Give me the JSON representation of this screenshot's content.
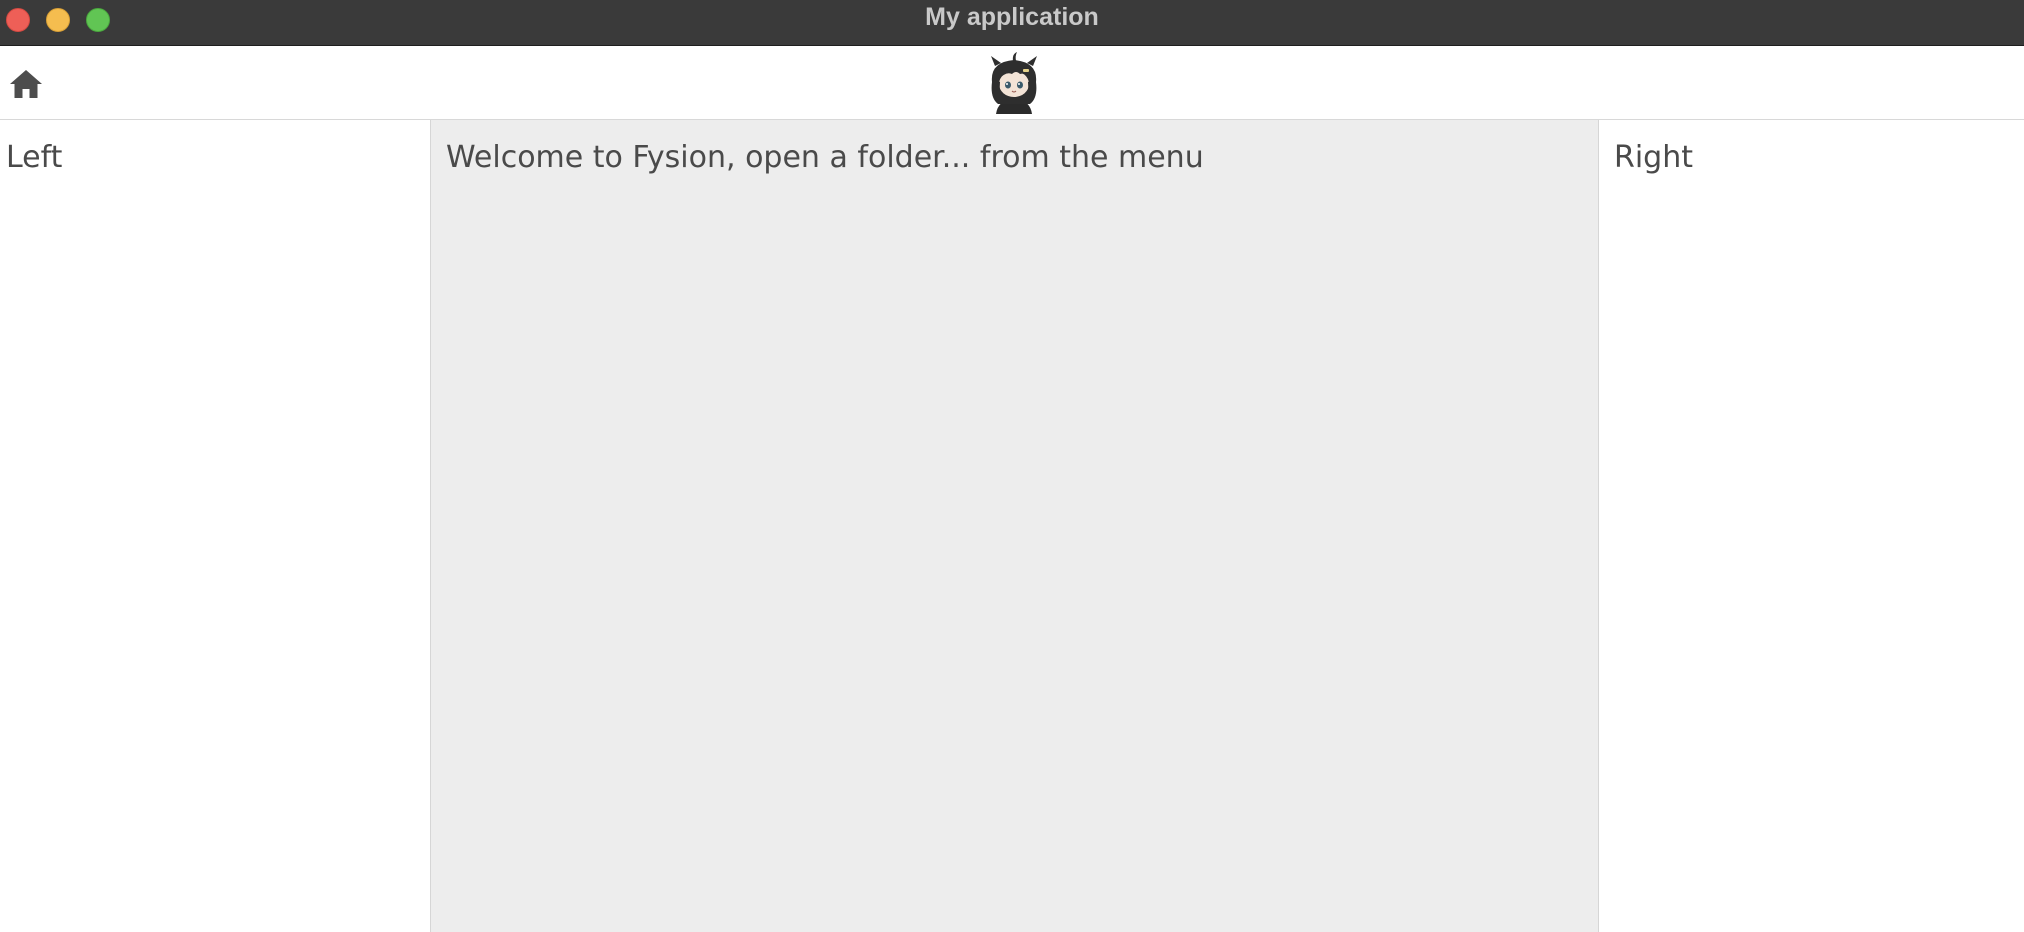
{
  "window": {
    "title": "My application",
    "controls": [
      "close",
      "minimize",
      "maximize"
    ]
  },
  "toolbar": {
    "home_icon": "home-icon",
    "avatar": "chibi-character-avatar"
  },
  "panels": {
    "left": {
      "label": "Left"
    },
    "center": {
      "message": "Welcome to Fysion, open a folder... from the menu"
    },
    "right": {
      "label": "Right"
    }
  },
  "colors": {
    "titlebar": "#3a3a3a",
    "close": "#ee5f57",
    "minimize": "#f5bd4f",
    "maximize": "#61c554",
    "center_panel": "#ededed",
    "text": "#4a4a4a"
  }
}
